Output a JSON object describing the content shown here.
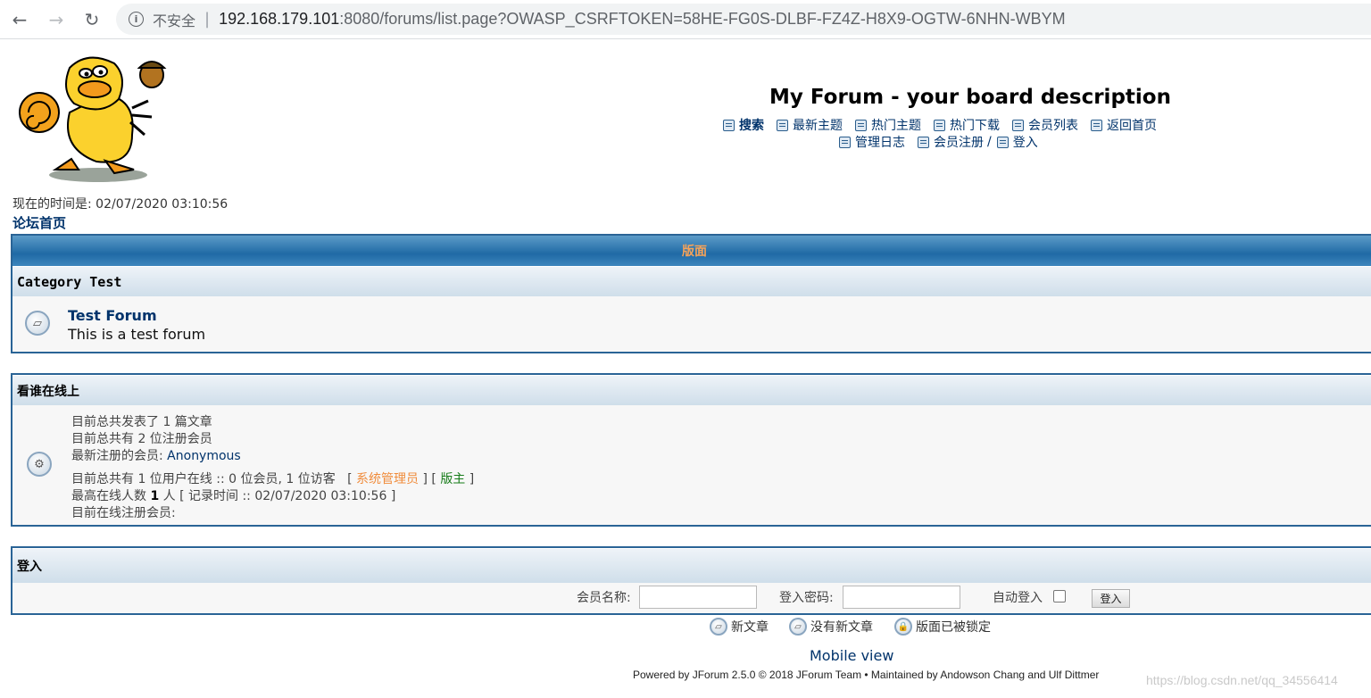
{
  "browser": {
    "insecure_label": "不安全",
    "url_host": "192.168.179.101",
    "url_rest": ":8080/forums/list.page?OWASP_CSRFTOKEN=58HE-FG0S-DLBF-FZ4Z-H8X9-OGTW-6NHN-WBYM"
  },
  "header": {
    "title": "My Forum - your board description",
    "menu_row1": [
      "搜索",
      "最新主题",
      "热门主题",
      "热门下载",
      "会员列表",
      "返回首页"
    ],
    "menu_row2": [
      "管理日志",
      "会员注册",
      "登入"
    ],
    "slash": "/"
  },
  "time_line": "现在的时间是: 02/07/2020 03:10:56",
  "home_link": "论坛首页",
  "forums_panel": {
    "header": "版面",
    "category": "Category Test",
    "forum_name": "Test Forum",
    "forum_desc": "This is a test forum"
  },
  "online_panel": {
    "header": "看谁在线上",
    "posts_line": "目前总共发表了 1 篇文章",
    "members_line": "目前总共有 2 位注册会员",
    "newest_prefix": "最新注册的会员: ",
    "newest_user": "Anonymous",
    "online_prefix": "目前总共有 1 位用户在线 :: 0 位会员, 1 位访客   [ ",
    "admin_label": "系统管理员",
    "mid_bracket": " ] [ ",
    "mod_label": "版主",
    "end_bracket": " ]",
    "max_prefix": "最高在线人数 ",
    "max_count": "1",
    "max_suffix": " 人 [ 记录时间 :: 02/07/2020 03:10:56 ]",
    "registered_online": "目前在线注册会员:"
  },
  "login_panel": {
    "header": "登入",
    "username_label": "会员名称:",
    "password_label": "登入密码:",
    "auto_login_label": "自动登入",
    "button_label": "登入"
  },
  "legend": {
    "new_posts": "新文章",
    "no_new_posts": "没有新文章",
    "locked": "版面已被锁定"
  },
  "footer": {
    "mobile_view": "Mobile view",
    "powered": "Powered by JForum 2.5.0 © 2018 JForum Team • Maintained by Andowson Chang and Ulf Dittmer"
  },
  "watermark": "https://blog.csdn.net/qq_34556414",
  "colors": {
    "link": "#01336b",
    "admin": "#f08c3c",
    "moderator": "#177c1a",
    "header_bar": "#1f6aa5"
  }
}
